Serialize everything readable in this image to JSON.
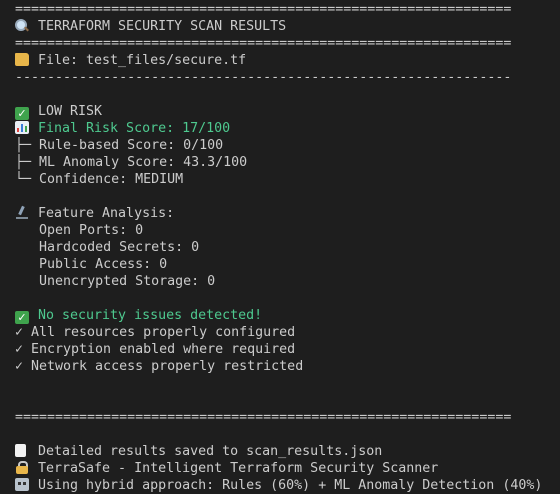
{
  "header": {
    "rule_top": "==============================================================",
    "title": "TERRAFORM SECURITY SCAN RESULTS",
    "rule_bottom": "=============================================================="
  },
  "file": {
    "label": "File: test_files/secure.tf"
  },
  "dash_rule": "--------------------------------------------------------------",
  "risk": {
    "level": "LOW RISK",
    "final_score": "Final Risk Score: 17/100",
    "rule_score": "Rule-based Score: 0/100",
    "ml_score": "ML Anomaly Score: 43.3/100",
    "confidence": "Confidence: MEDIUM"
  },
  "features": {
    "heading": "Feature Analysis:",
    "open_ports": "Open Ports: 0",
    "hardcoded_secrets": "Hardcoded Secrets: 0",
    "public_access": "Public Access: 0",
    "unencrypted_storage": "Unencrypted Storage: 0"
  },
  "result": {
    "headline": "No security issues detected!",
    "items": [
      "✓ All resources properly configured",
      "✓ Encryption enabled where required",
      "✓ Network access properly restricted"
    ]
  },
  "footer": {
    "rule": "==============================================================",
    "saved": "Detailed results saved to scan_results.json",
    "product": "TerraSafe - Intelligent Terraform Security Scanner",
    "approach": "Using hybrid approach: Rules (60%) + ML Anomaly Detection (40%)"
  },
  "tree": {
    "branch": "├─",
    "last": "└─"
  },
  "colors": {
    "background": "#1e1e1e",
    "text": "#cccccc",
    "success": "#4ec98f"
  },
  "icons": {
    "title": "magnifier-icon",
    "file": "folder-icon",
    "risk": "check-icon",
    "score": "chart-icon",
    "features": "microscope-icon",
    "result": "check-icon",
    "saved": "document-icon",
    "product": "lock-icon",
    "approach": "robot-icon"
  }
}
